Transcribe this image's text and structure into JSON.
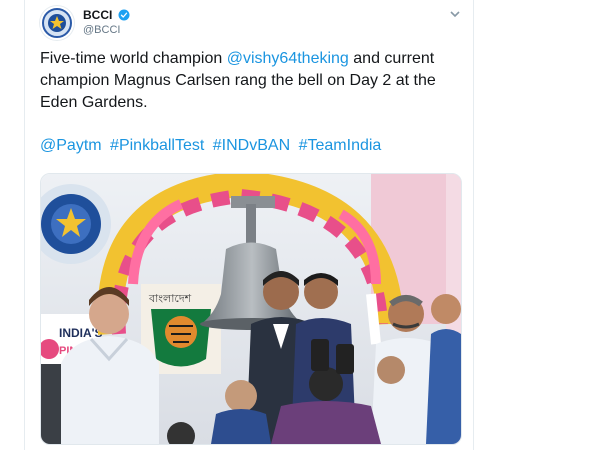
{
  "author": {
    "name": "BCCI",
    "handle": "@BCCI"
  },
  "tweet": {
    "text_before_mention": "Five-time world champion ",
    "mention": "@vishy64theking",
    "text_after_mention": " and current champion Magnus Carlsen rang the bell on Day 2 at the Eden Gardens.",
    "tags": [
      "@Paytm",
      "#PinkballTest",
      "#INDvBAN",
      "#TeamIndia"
    ]
  },
  "photo": {
    "bangladesh_label": "বাংলাদেশ",
    "india_text": "INDIA'S",
    "pink_text": "PINK"
  },
  "colors": {
    "link": "#1b95e0",
    "verified": "#1da1f2",
    "text": "#14171a",
    "muted": "#657786"
  }
}
